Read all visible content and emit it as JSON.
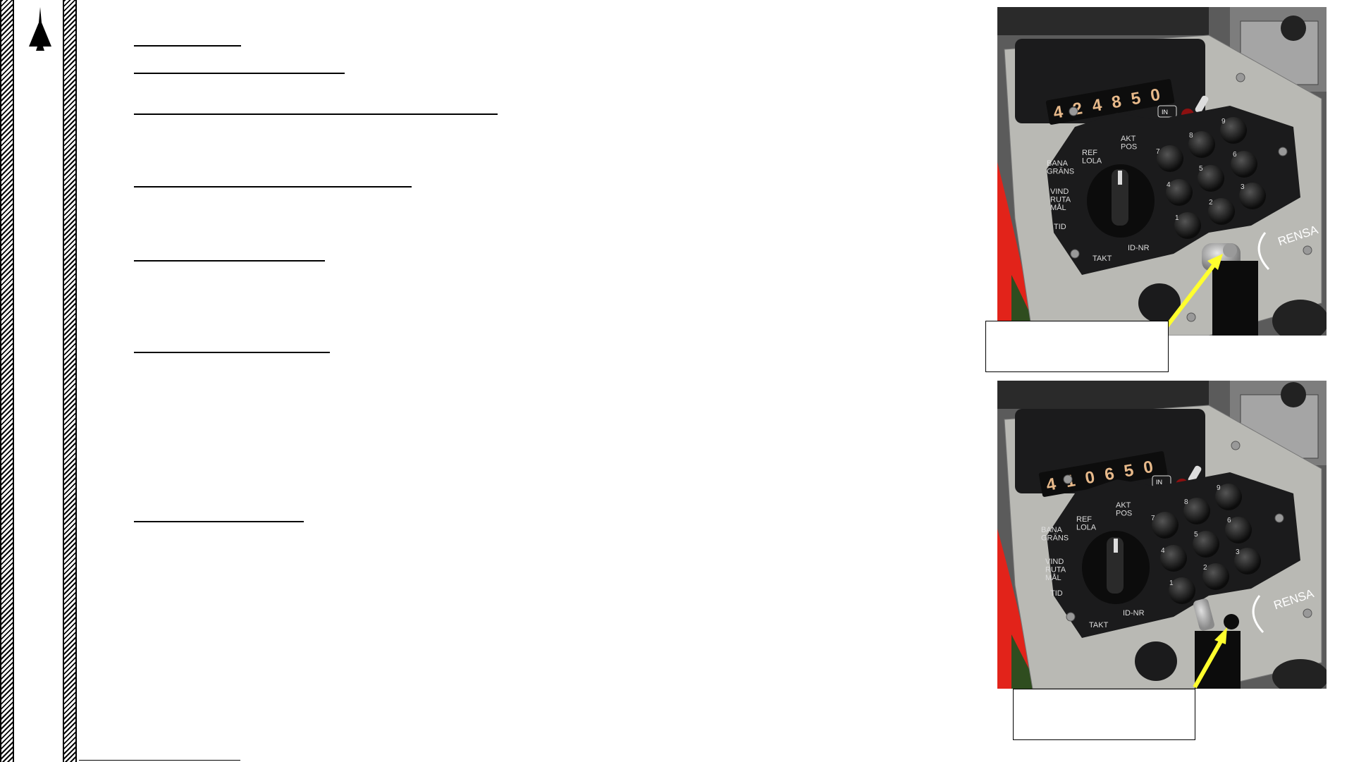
{
  "page": {
    "headings": [
      "",
      "",
      "",
      "",
      "",
      "",
      ""
    ]
  },
  "photos": {
    "top": {
      "counter_digits": [
        "4",
        "2",
        "4",
        "8",
        "5",
        "0"
      ],
      "selector_labels": [
        "BANA\nGRÄNS",
        "REF\nLOLA",
        "AKT\nPOS",
        "VIND\nRUTA\nMÅL",
        "TID",
        "TAKT",
        "ID-NR"
      ],
      "indicator_label": "IN",
      "button_label": "RENSA",
      "keypad_numbers": [
        "7",
        "8",
        "9",
        "4",
        "5",
        "6",
        "1",
        "2",
        "3"
      ],
      "callout": ""
    },
    "bottom": {
      "counter_digits": [
        "4",
        "1",
        "0",
        "6",
        "5",
        "0"
      ],
      "selector_labels": [
        "BANA\nGRÄNS",
        "REF\nLOLA",
        "AKT\nPOS",
        "VIND\nRUTA\nMÅL",
        "TID",
        "TAKT",
        "ID-NR"
      ],
      "indicator_label": "IN",
      "button_label": "RENSA",
      "keypad_numbers": [
        "7",
        "8",
        "9",
        "4",
        "5",
        "6",
        "1",
        "2",
        "3"
      ],
      "callout": ""
    }
  },
  "colors": {
    "panel": "#b9b9b4",
    "panel_dark": "#1b1b1c",
    "red_trim": "#e2231a",
    "arrow": "#ffff2e",
    "counter_digit": "#e7b98a"
  }
}
